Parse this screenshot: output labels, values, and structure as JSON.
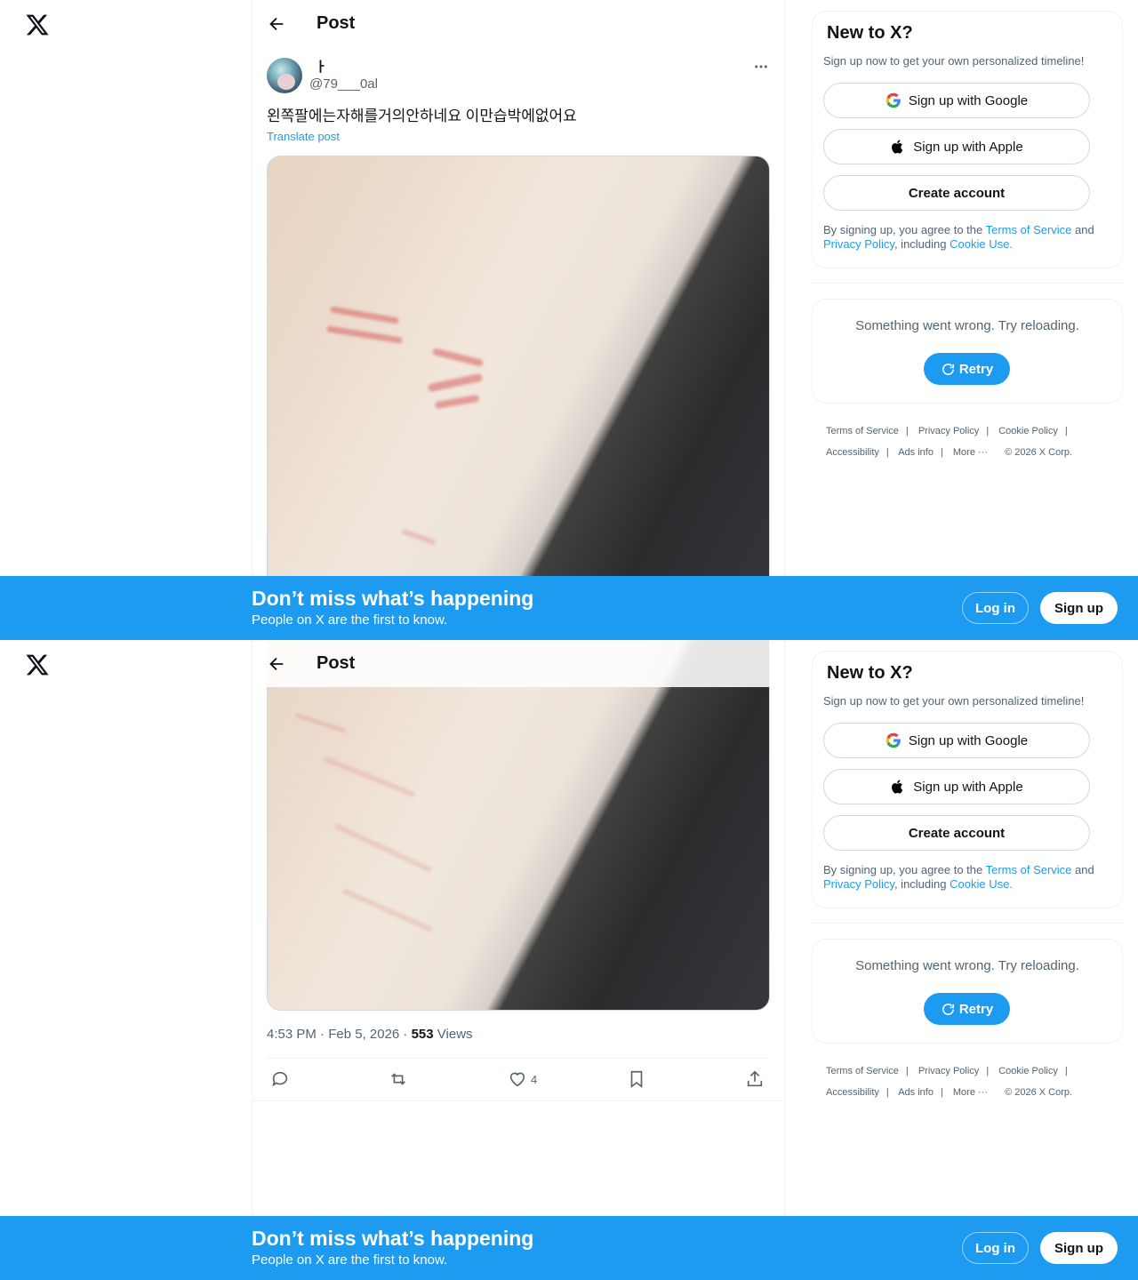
{
  "header": {
    "title": "Post"
  },
  "post": {
    "display_name": "ㅏ",
    "handle": "@79___0al",
    "text": "왼쪽팔에는자해를거의안하네요 이만습박에없어요",
    "translate": "Translate post",
    "timestamp": "4:53 PM · Feb 5, 2026 · ",
    "views_count": "553",
    "views_label": " Views",
    "likes": "4"
  },
  "sidebar": {
    "title": "New to X?",
    "subtitle": "Sign up now to get your own personalized timeline!",
    "google": "Sign up with Google",
    "apple": "Sign up with Apple",
    "create": "Create account",
    "legal_1": "By signing up, you agree to the ",
    "tos": "Terms of Service",
    "legal_2": " and ",
    "privacy": "Privacy Policy",
    "legal_3": ", including ",
    "cookie": "Cookie Use.",
    "error": "Something went wrong. Try reloading.",
    "retry": "Retry"
  },
  "footer": {
    "links": [
      "Terms of Service",
      "Privacy Policy",
      "Cookie Policy",
      "Accessibility",
      "Ads info",
      "More ···",
      "© 2026 X Corp."
    ]
  },
  "banner": {
    "title": "Don’t miss what’s happening",
    "subtitle": "People on X are the first to know.",
    "login": "Log in",
    "signup": "Sign up"
  },
  "colors": {
    "accent": "#1d9bf0",
    "text": "#0f1419",
    "muted": "#536471"
  }
}
